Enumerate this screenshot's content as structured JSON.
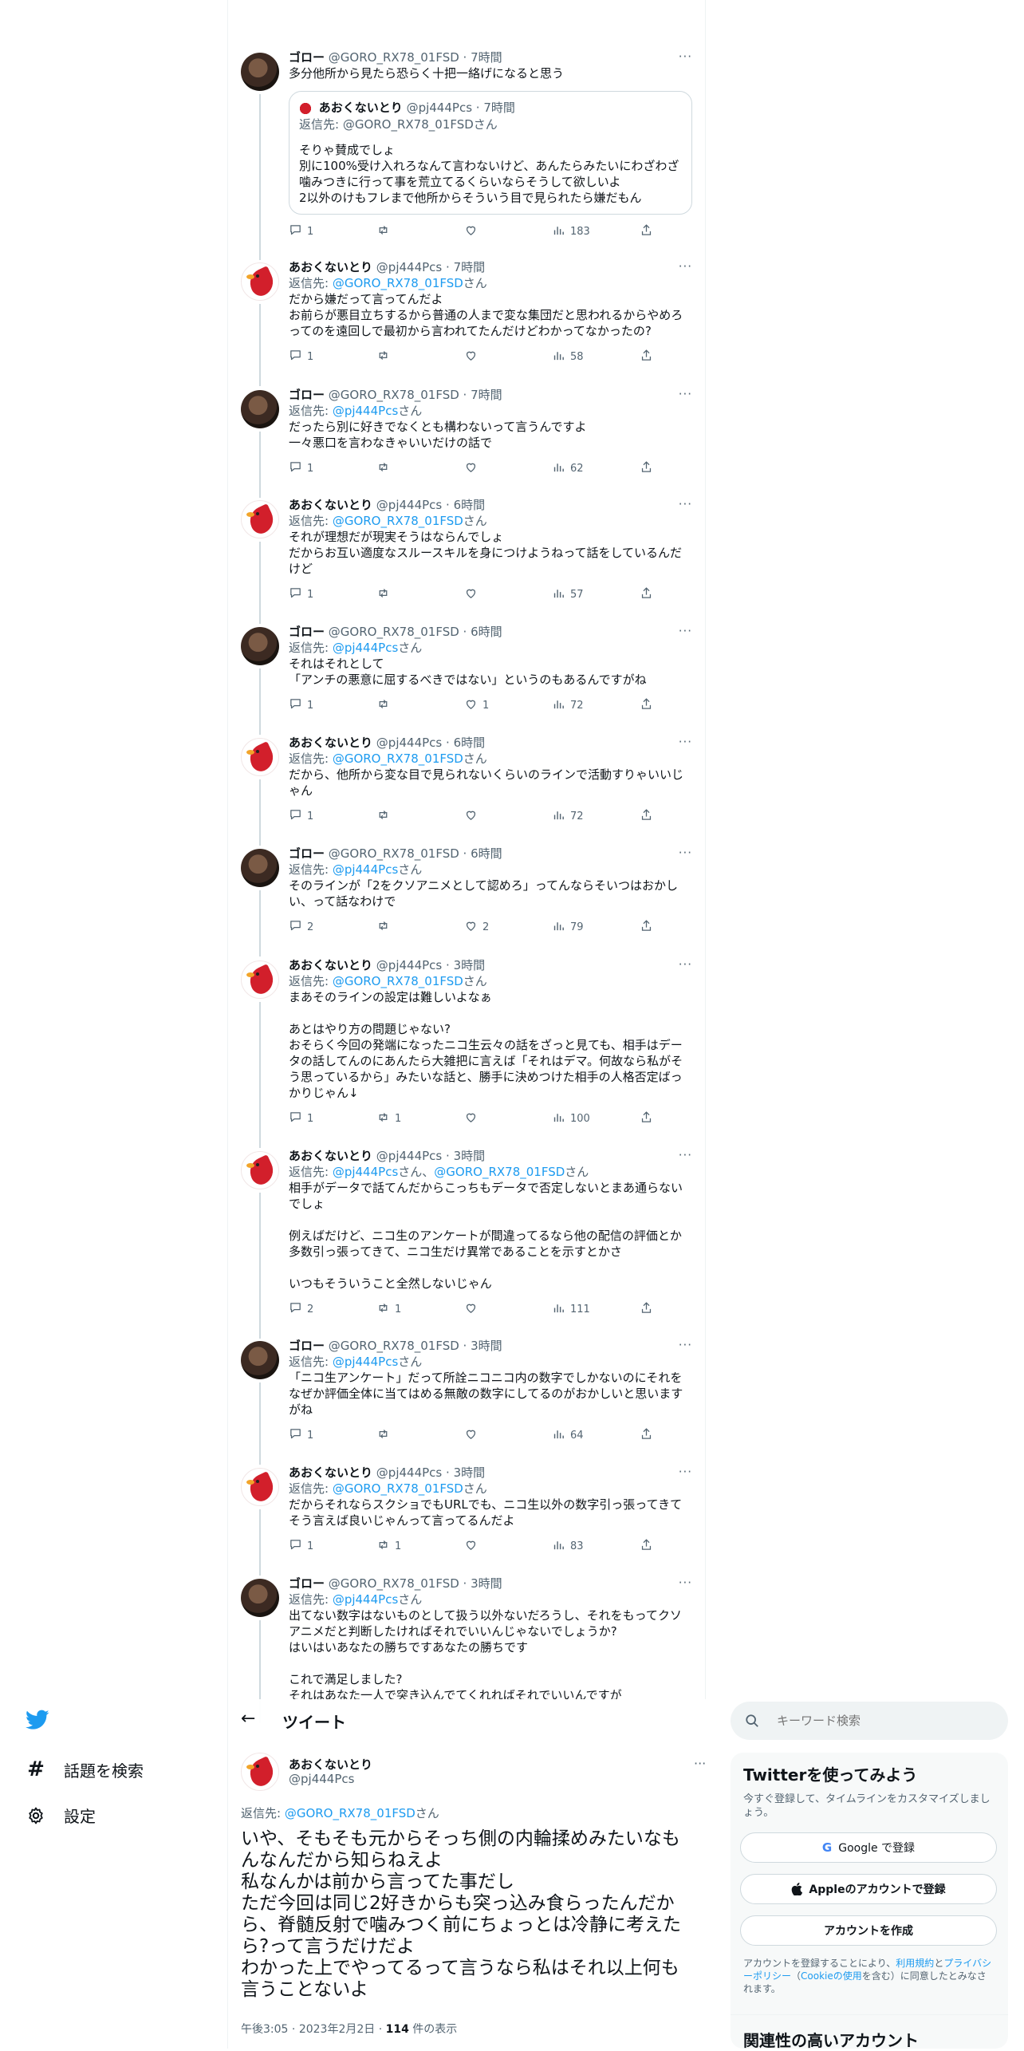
{
  "app": {
    "logo": "twitter-bird-icon",
    "brand_color": "#1d9bf0"
  },
  "nav": {
    "explore_label": "話題を検索",
    "settings_label": "設定"
  },
  "thread": [
    {
      "author": "goro",
      "name": "ゴロー",
      "handle": "@GORO_RX78_01FSD",
      "time": "7時間",
      "reply_to": null,
      "text": "多分他所から見たら恐らく十把一絡げになると思う",
      "quote": {
        "name": "あおくないとり",
        "handle": "@pj444Pcs",
        "time": "7時間",
        "reply_prefix": "返信先: ",
        "reply_to": "@GORO_RX78_01FSD",
        "reply_suffix": "さん",
        "text": "そりゃ賛成でしょ\n別に100%受け入れろなんて言わないけど、あんたらみたいにわざわざ噛みつきに行って事を荒立てるくらいならそうして欲しいよ\n2以外のけもフレまで他所からそういう目で見られたら嫌だもん"
      },
      "replies": "1",
      "retweets": "",
      "likes": "",
      "views": "183"
    },
    {
      "author": "ao",
      "name": "あおくないとり",
      "handle": "@pj444Pcs",
      "time": "7時間",
      "reply_to": "@GORO_RX78_01FSD",
      "text": "だから嫌だって言ってんだよ\nお前らが悪目立ちするから普通の人まで変な集団だと思われるからやめろってのを遠回しで最初から言われてたんだけどわかってなかったの?",
      "replies": "1",
      "retweets": "",
      "likes": "",
      "views": "58"
    },
    {
      "author": "goro",
      "name": "ゴロー",
      "handle": "@GORO_RX78_01FSD",
      "time": "7時間",
      "reply_to": "@pj444Pcs",
      "text": "だったら別に好きでなくとも構わないって言うんですよ\n一々悪口を言わなきゃいいだけの話で",
      "replies": "1",
      "retweets": "",
      "likes": "",
      "views": "62"
    },
    {
      "author": "ao",
      "name": "あおくないとり",
      "handle": "@pj444Pcs",
      "time": "6時間",
      "reply_to": "@GORO_RX78_01FSD",
      "text": "それが理想だが現実そうはならんでしょ\nだからお互い適度なスルースキルを身につけようねって話をしているんだけど",
      "replies": "1",
      "retweets": "",
      "likes": "",
      "views": "57"
    },
    {
      "author": "goro",
      "name": "ゴロー",
      "handle": "@GORO_RX78_01FSD",
      "time": "6時間",
      "reply_to": "@pj444Pcs",
      "text": "それはそれとして\n「アンチの悪意に屈するべきではない」というのもあるんですがね",
      "replies": "1",
      "retweets": "",
      "likes": "1",
      "views": "72"
    },
    {
      "author": "ao",
      "name": "あおくないとり",
      "handle": "@pj444Pcs",
      "time": "6時間",
      "reply_to": "@GORO_RX78_01FSD",
      "text": "だから、他所から変な目で見られないくらいのラインで活動すりゃいいじゃん",
      "replies": "1",
      "retweets": "",
      "likes": "",
      "views": "72"
    },
    {
      "author": "goro",
      "name": "ゴロー",
      "handle": "@GORO_RX78_01FSD",
      "time": "6時間",
      "reply_to": "@pj444Pcs",
      "text": "そのラインが「2をクソアニメとして認めろ」ってんならそいつはおかしい、って話なわけで",
      "replies": "2",
      "retweets": "",
      "likes": "2",
      "views": "79"
    },
    {
      "author": "ao",
      "name": "あおくないとり",
      "handle": "@pj444Pcs",
      "time": "3時間",
      "reply_to": "@GORO_RX78_01FSD",
      "text": "まあそのラインの設定は難しいよなぁ\n\nあとはやり方の問題じゃない?\nおそらく今回の発端になったニコ生云々の話をざっと見ても、相手はデータの話してんのにあんたら大雑把に言えば「それはデマ。何故なら私がそう思っているから」みたいな話と、勝手に決めつけた相手の人格否定ばっかりじゃん↓",
      "replies": "1",
      "retweets": "1",
      "likes": "",
      "views": "100"
    },
    {
      "author": "ao",
      "name": "あおくないとり",
      "handle": "@pj444Pcs",
      "time": "3時間",
      "reply_to": "@pj444Pcs",
      "reply_to2": "@GORO_RX78_01FSD",
      "text": "相手がデータで話てんだからこっちもデータで否定しないとまあ通らないでしょ\n\n例えばだけど、ニコ生のアンケートが間違ってるなら他の配信の評価とか多数引っ張ってきて、ニコ生だけ異常であることを示すとかさ\n\nいつもそういうこと全然しないじゃん",
      "replies": "2",
      "retweets": "1",
      "likes": "",
      "views": "111"
    },
    {
      "author": "goro",
      "name": "ゴロー",
      "handle": "@GORO_RX78_01FSD",
      "time": "3時間",
      "reply_to": "@pj444Pcs",
      "text": "「ニコ生アンケート」だって所詮ニコニコ内の数字でしかないのにそれをなぜか評価全体に当てはめる無敵の数字にしてるのがおかしいと思いますがね",
      "replies": "1",
      "retweets": "",
      "likes": "",
      "views": "64"
    },
    {
      "author": "ao",
      "name": "あおくないとり",
      "handle": "@pj444Pcs",
      "time": "3時間",
      "reply_to": "@GORO_RX78_01FSD",
      "text": "だからそれならスクショでもURLでも、ニコ生以外の数字引っ張ってきてそう言えば良いじゃんって言ってるんだよ",
      "replies": "1",
      "retweets": "1",
      "likes": "",
      "views": "83"
    },
    {
      "author": "goro",
      "name": "ゴロー",
      "handle": "@GORO_RX78_01FSD",
      "time": "3時間",
      "reply_to": "@pj444Pcs",
      "text": "出てない数字はないものとして扱う以外ないだろうし、それをもってクソアニメだと判断したければそれでいいんじゃないでしょうか?\nはいはいあなたの勝ちですあなたの勝ちです\n\nこれで満足しました?\nそれはあなた一人で突き込んでてくれればそれでいいんですが",
      "replies": "",
      "retweets": "",
      "likes": "",
      "views": ""
    }
  ],
  "common": {
    "reply_prefix": "返信先: ",
    "san": "さん",
    "and_sep": "、",
    "dot": "·"
  },
  "header": {
    "back": "←",
    "title": "ツイート"
  },
  "focus": {
    "name": "あおくないとり",
    "handle": "@pj444Pcs",
    "reply_to": "@GORO_RX78_01FSD",
    "text": "いや、そもそも元からそっち側の内輪揉めみたいなもんなんだから知らねえよ\n私なんかは前から言ってた事だし\nただ今回は同じ2好きからも突っ込み食らったんだから、脊髄反射で噛みつく前にちょっとは冷静に考えたら?って言うだけだよ\nわかった上でやってるって言うなら私はそれ以上何も言うことないよ",
    "time": "午後3:05",
    "date": "2023年2月2日",
    "views_count": "114",
    "views_label": " 件の表示"
  },
  "sidebar": {
    "search_placeholder": "キーワード検索",
    "signup_title": "Twitterを使ってみよう",
    "signup_sub": "今すぐ登録して、タイムラインをカスタマイズしましょう。",
    "google_button": "Google で登録",
    "apple_button": "Appleのアカウントで登録",
    "create_button": "アカウントを作成",
    "terms_pre": "アカウントを登録することにより、",
    "terms_link": "利用規約",
    "terms_and": "と",
    "privacy_link": "プライバシーポリシー",
    "terms_mid": "（",
    "cookie_link": "Cookieの使用",
    "terms_post": "を含む）に同意したとみなされます。",
    "related_title": "関連性の高いアカウント"
  }
}
